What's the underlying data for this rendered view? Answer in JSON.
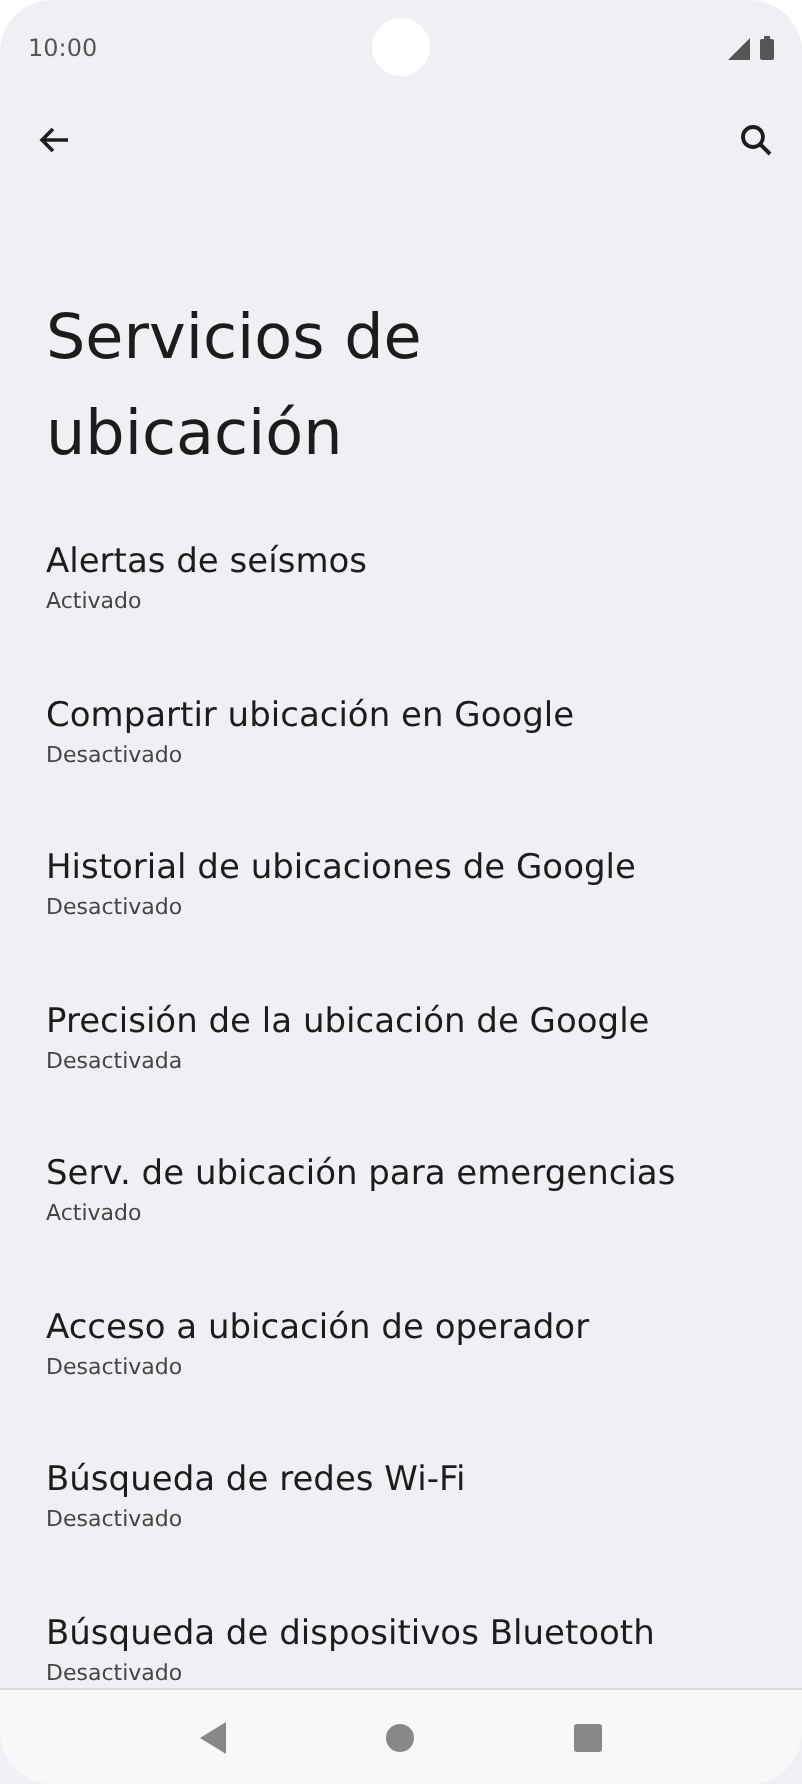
{
  "status_bar": {
    "time": "10:00"
  },
  "title": "Servicios de ubicación",
  "items": [
    {
      "title": "Alertas de seísmos",
      "subtitle": "Activado"
    },
    {
      "title": "Compartir ubicación en Google",
      "subtitle": "Desactivado"
    },
    {
      "title": "Historial de ubicaciones de Google",
      "subtitle": "Desactivado"
    },
    {
      "title": "Precisión de la ubicación de Google",
      "subtitle": "Desactivada"
    },
    {
      "title": "Serv. de ubicación para emergencias",
      "subtitle": "Activado"
    },
    {
      "title": "Acceso a ubicación de operador",
      "subtitle": "Desactivado"
    },
    {
      "title": "Búsqueda de redes Wi-Fi",
      "subtitle": "Desactivado"
    },
    {
      "title": "Búsqueda de dispositivos Bluetooth",
      "subtitle": "Desactivado"
    }
  ]
}
